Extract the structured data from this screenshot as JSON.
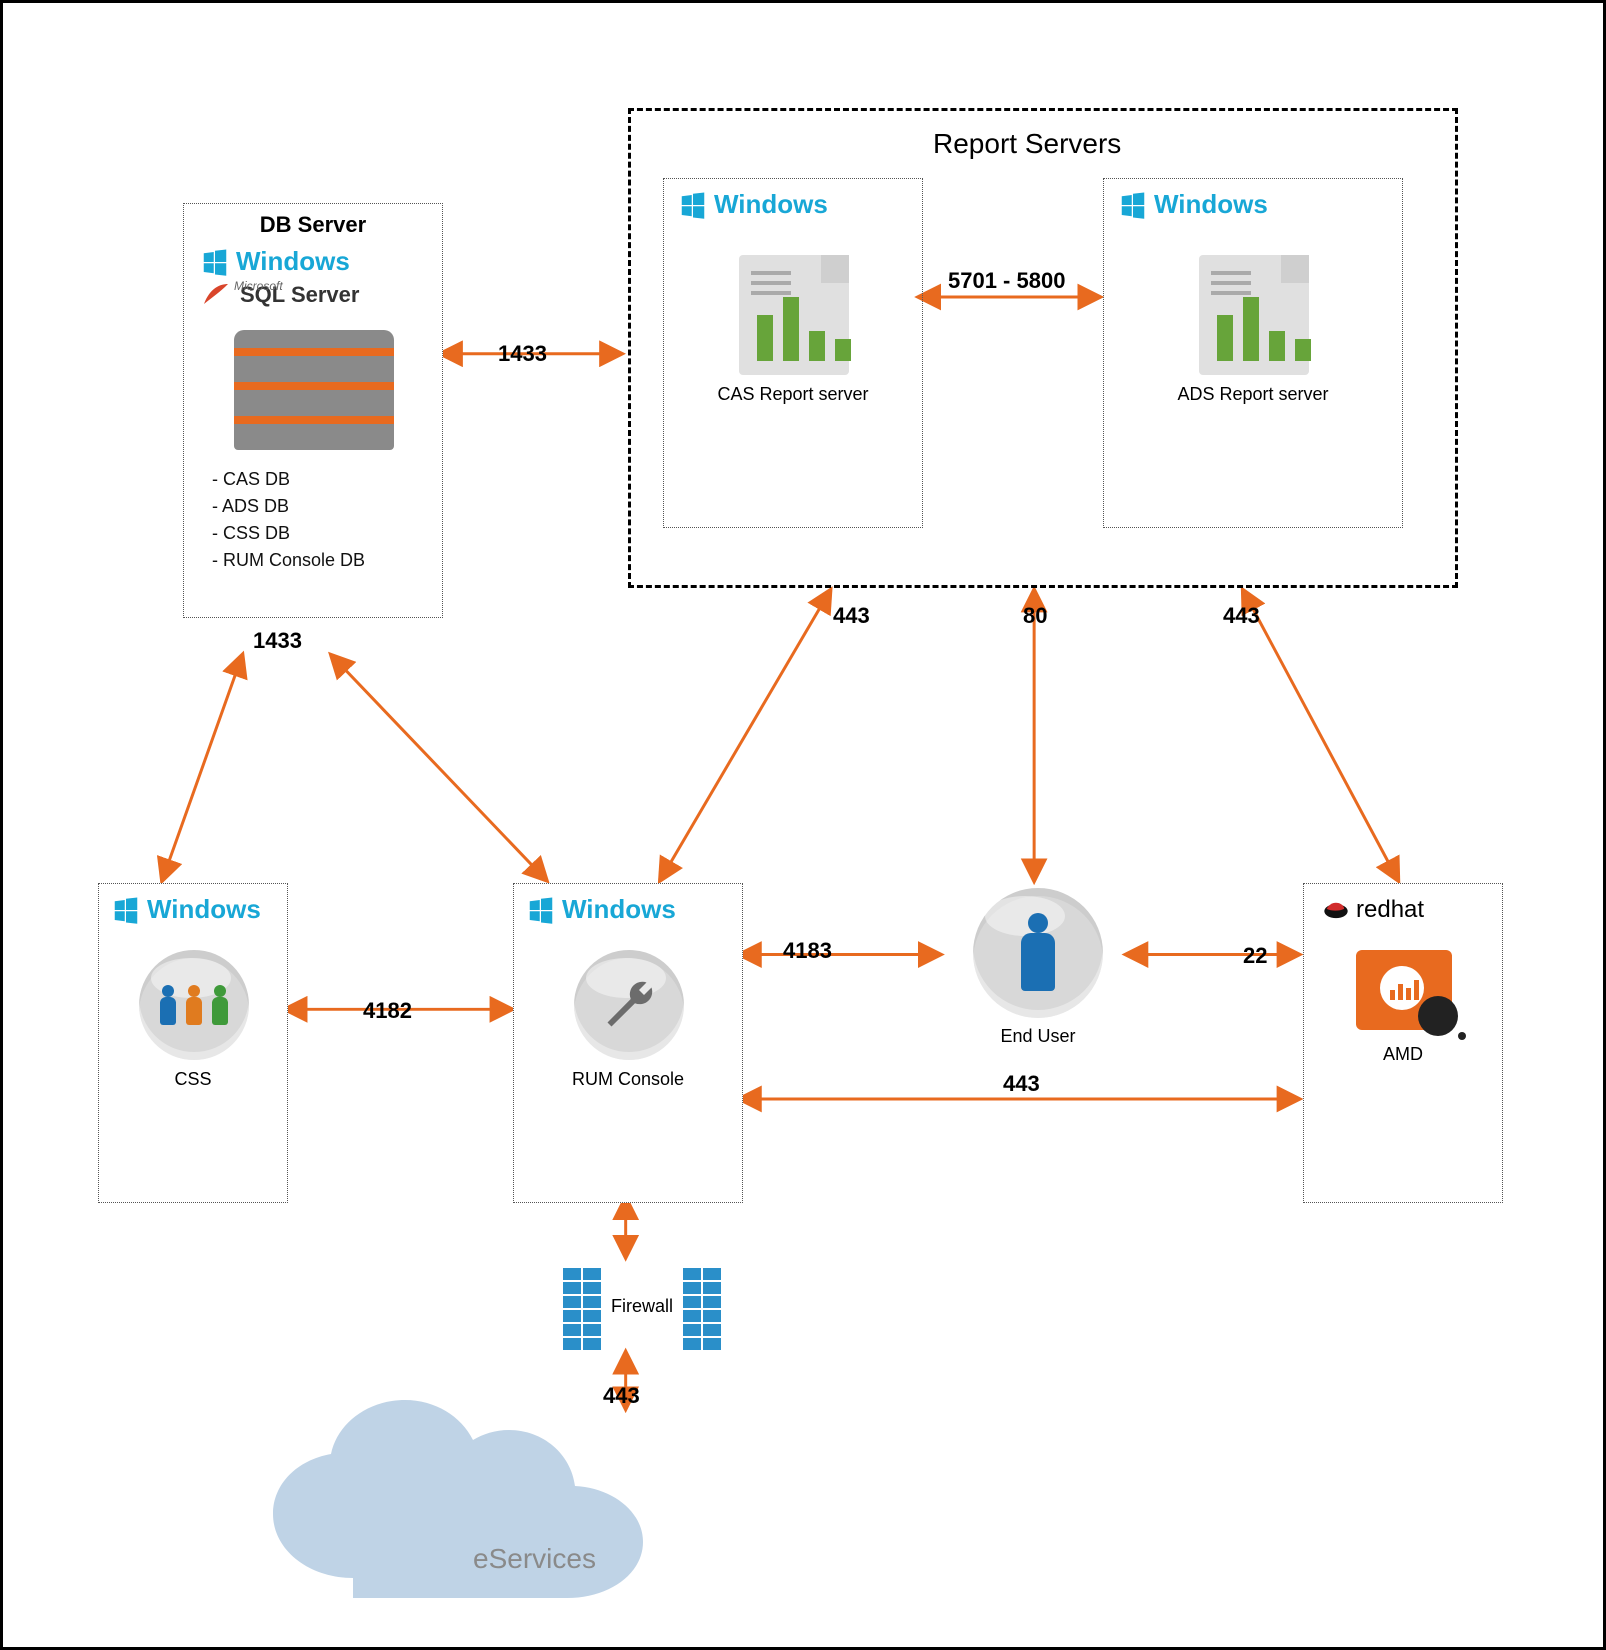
{
  "groups": {
    "report_servers": "Report Servers"
  },
  "nodes": {
    "db_server": {
      "title": "DB Server",
      "os": "Windows",
      "engine": "SQL Server",
      "engine_vendor": "Microsoft",
      "databases": [
        "- CAS DB",
        "- ADS DB",
        "- CSS DB",
        "- RUM Console DB"
      ]
    },
    "cas_report": {
      "os": "Windows",
      "label": "CAS Report server"
    },
    "ads_report": {
      "os": "Windows",
      "label": "ADS Report server"
    },
    "css": {
      "os": "Windows",
      "label": "CSS"
    },
    "rum": {
      "os": "Windows",
      "label": "RUM Console"
    },
    "end_user": {
      "label": "End User"
    },
    "amd": {
      "os": "redhat",
      "label": "AMD"
    },
    "firewall": {
      "label": "Firewall"
    },
    "eservices": {
      "label": "eServices"
    }
  },
  "ports": {
    "db_to_report": "1433",
    "db_below": "1433",
    "cas_to_ads": "5701 - 5800",
    "report_left_443": "443",
    "report_mid_80": "80",
    "report_right_443": "443",
    "css_to_rum": "4182",
    "rum_to_user": "4183",
    "user_to_amd": "22",
    "rum_to_amd_443": "443",
    "firewall_443": "443"
  }
}
